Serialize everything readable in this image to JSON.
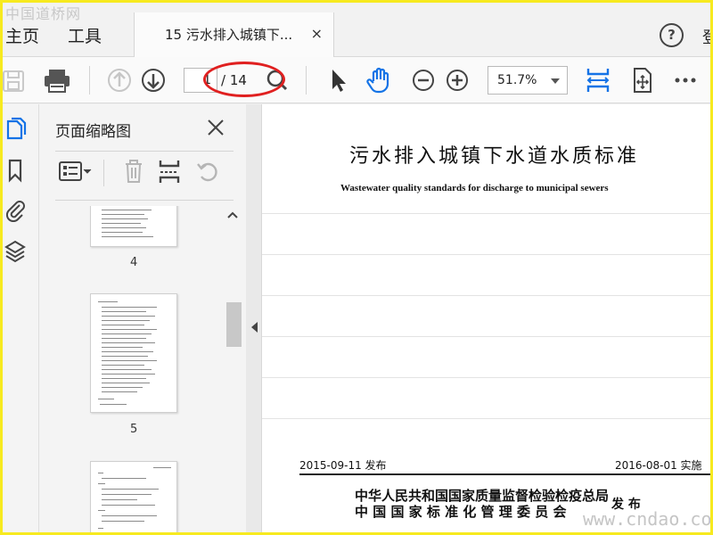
{
  "watermarks": {
    "top": "中国道桥网",
    "bottom": "www.cndao.com"
  },
  "menubar": {
    "home": "主页",
    "tools": "工具",
    "tab_label": "15 污水排入城镇下...",
    "tab_close": "×",
    "help": "?",
    "signin_clip": "登"
  },
  "toolbar": {
    "current_page": "1",
    "total_pages": "/ 14",
    "zoom": "51.7%",
    "highlight_color": "#e02020",
    "accent_color": "#1473e6"
  },
  "thumbnail_panel": {
    "title": "页面缩略图",
    "thumbnails": [
      {
        "page": "4"
      },
      {
        "page": "5"
      }
    ]
  },
  "document": {
    "title": "污水排入城镇下水道水质标准",
    "subtitle": "Wastewater quality standards for discharge to municipal sewers",
    "release_date": "2015-09-11 发布",
    "effective_date": "2016-08-01 实施",
    "issuer_line1": "中华人民共和国国家质量监督检验检疫总局",
    "issuer_line2": "中 国 国 家 标 准 化 管 理 委 员 会",
    "issue_word": "发 布"
  }
}
